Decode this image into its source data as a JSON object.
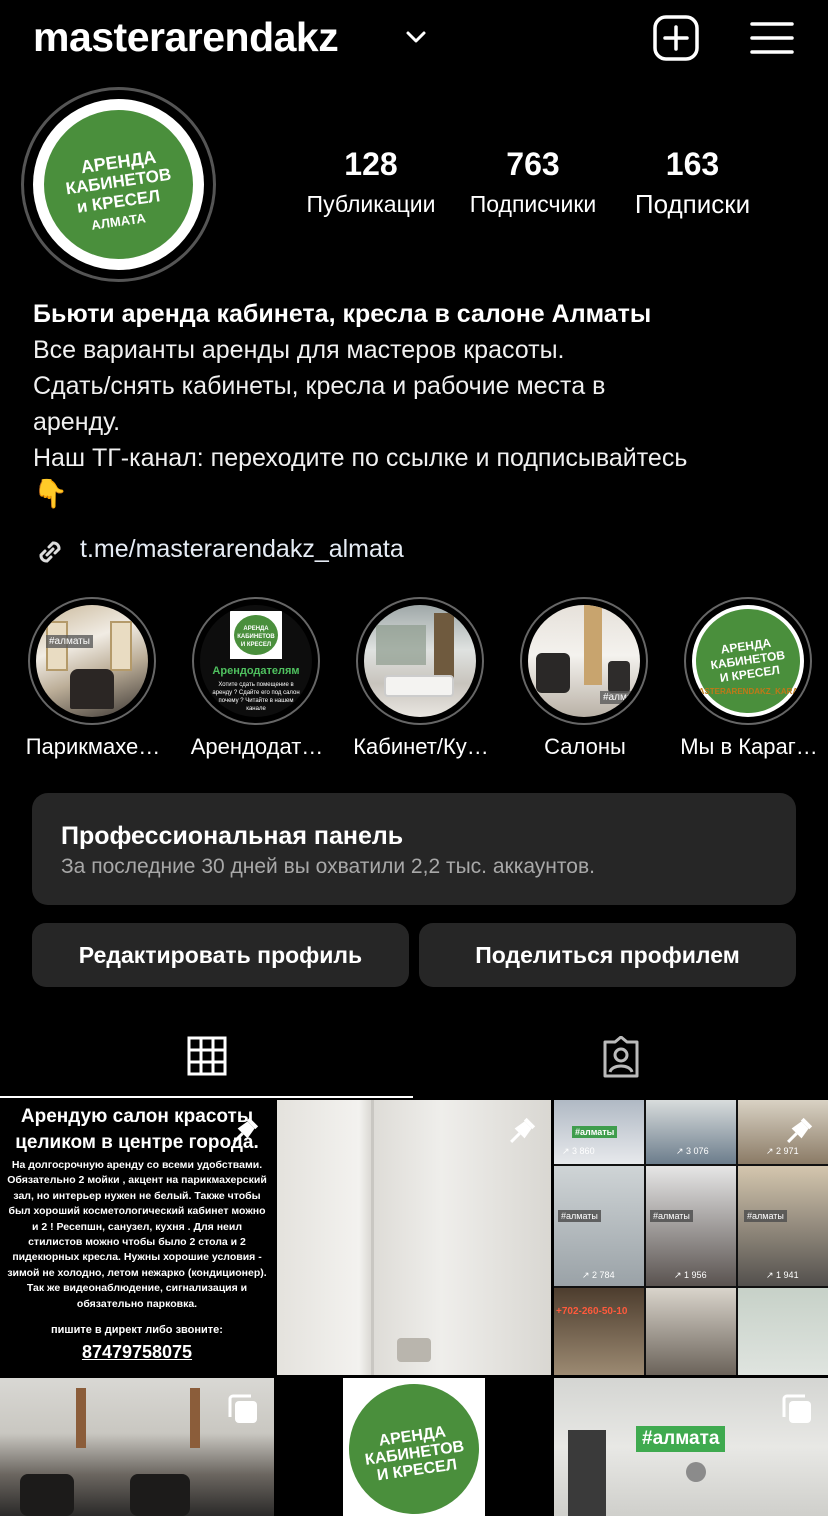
{
  "header": {
    "username": "masterarendakz"
  },
  "avatar_logo": {
    "line1": "АРЕНДА",
    "line2": "КАБИНЕТОВ",
    "line3": "и КРЕСЕЛ",
    "line4": "АЛМАТА"
  },
  "stats": [
    {
      "value": "128",
      "label": "Публикации"
    },
    {
      "value": "763",
      "label": "Подписчики"
    },
    {
      "value": "163",
      "label": "Подписки"
    }
  ],
  "bio": {
    "title": "Бьюти аренда кабинета, кресла в салоне Алматы",
    "lines": [
      "Все варианты аренды для мастеров красоты.",
      "Сдать/снять кабинеты, кресла и рабочие места в",
      "аренду.",
      "Наш ТГ-канал: переходите по ссылке и подписывайтесь"
    ],
    "emoji": "👇",
    "link": "t.me/masterarendakz_almata"
  },
  "highlights": [
    {
      "label": "Парикмахе…",
      "tag": "#алматы"
    },
    {
      "label": "Арендодат…",
      "caption": "Арендодателям",
      "small": "Хотите сдать помещение в аренду ? Сдайте его под салон почему ? Читайте в нашем канале"
    },
    {
      "label": "Кабинет/Ку…"
    },
    {
      "label": "Салоны",
      "tag": "#алматы"
    },
    {
      "label": "Мы в Караг…",
      "caption": "MASTERARENDAKZ_KARAGANDA"
    }
  ],
  "pro_panel": {
    "title": "Профессиональная панель",
    "subtitle": "За последние 30 дней вы охватили 2,2 тыс. аккаунтов."
  },
  "buttons": {
    "edit": "Редактировать профиль",
    "share": "Поделиться профилем"
  },
  "posts": {
    "post1": {
      "title1": "Арендую салон красоты",
      "title2": "целиком в центре города.",
      "body": "На долгосрочную аренду со всеми удобствами. Обязательно 2 мойки , акцент на парикмахерский зал, но интерьер нужен не белый. Также чтобы был хороший косметологический кабинет можно и 2 ! Ресепшн, санузел, кухня . Для неил стилистов можно чтобы было 2 стола и 2 пидекюрных кресла. Нужны хорошие условия - зимой не холодно, летом нежарко (кондиционер). Так же видеонаблюдение, сигнализация и обязательно парковка.",
      "contact": "пишите в директ либо звоните:",
      "phone": "87479758075"
    },
    "collage": {
      "tags": [
        "#алматы",
        "#алматы",
        "#алматы",
        "#алматы"
      ],
      "views": [
        "3 860",
        "3 076",
        "2 971",
        "2 784",
        "1 956",
        "1 941"
      ],
      "phone": "+702-260-50-10"
    },
    "post6_tag": "#алмата"
  },
  "colors": {
    "background": "#000000",
    "panel": "#262626",
    "brand_green": "#4a8f3c",
    "muted_text": "#a8a8a8"
  }
}
